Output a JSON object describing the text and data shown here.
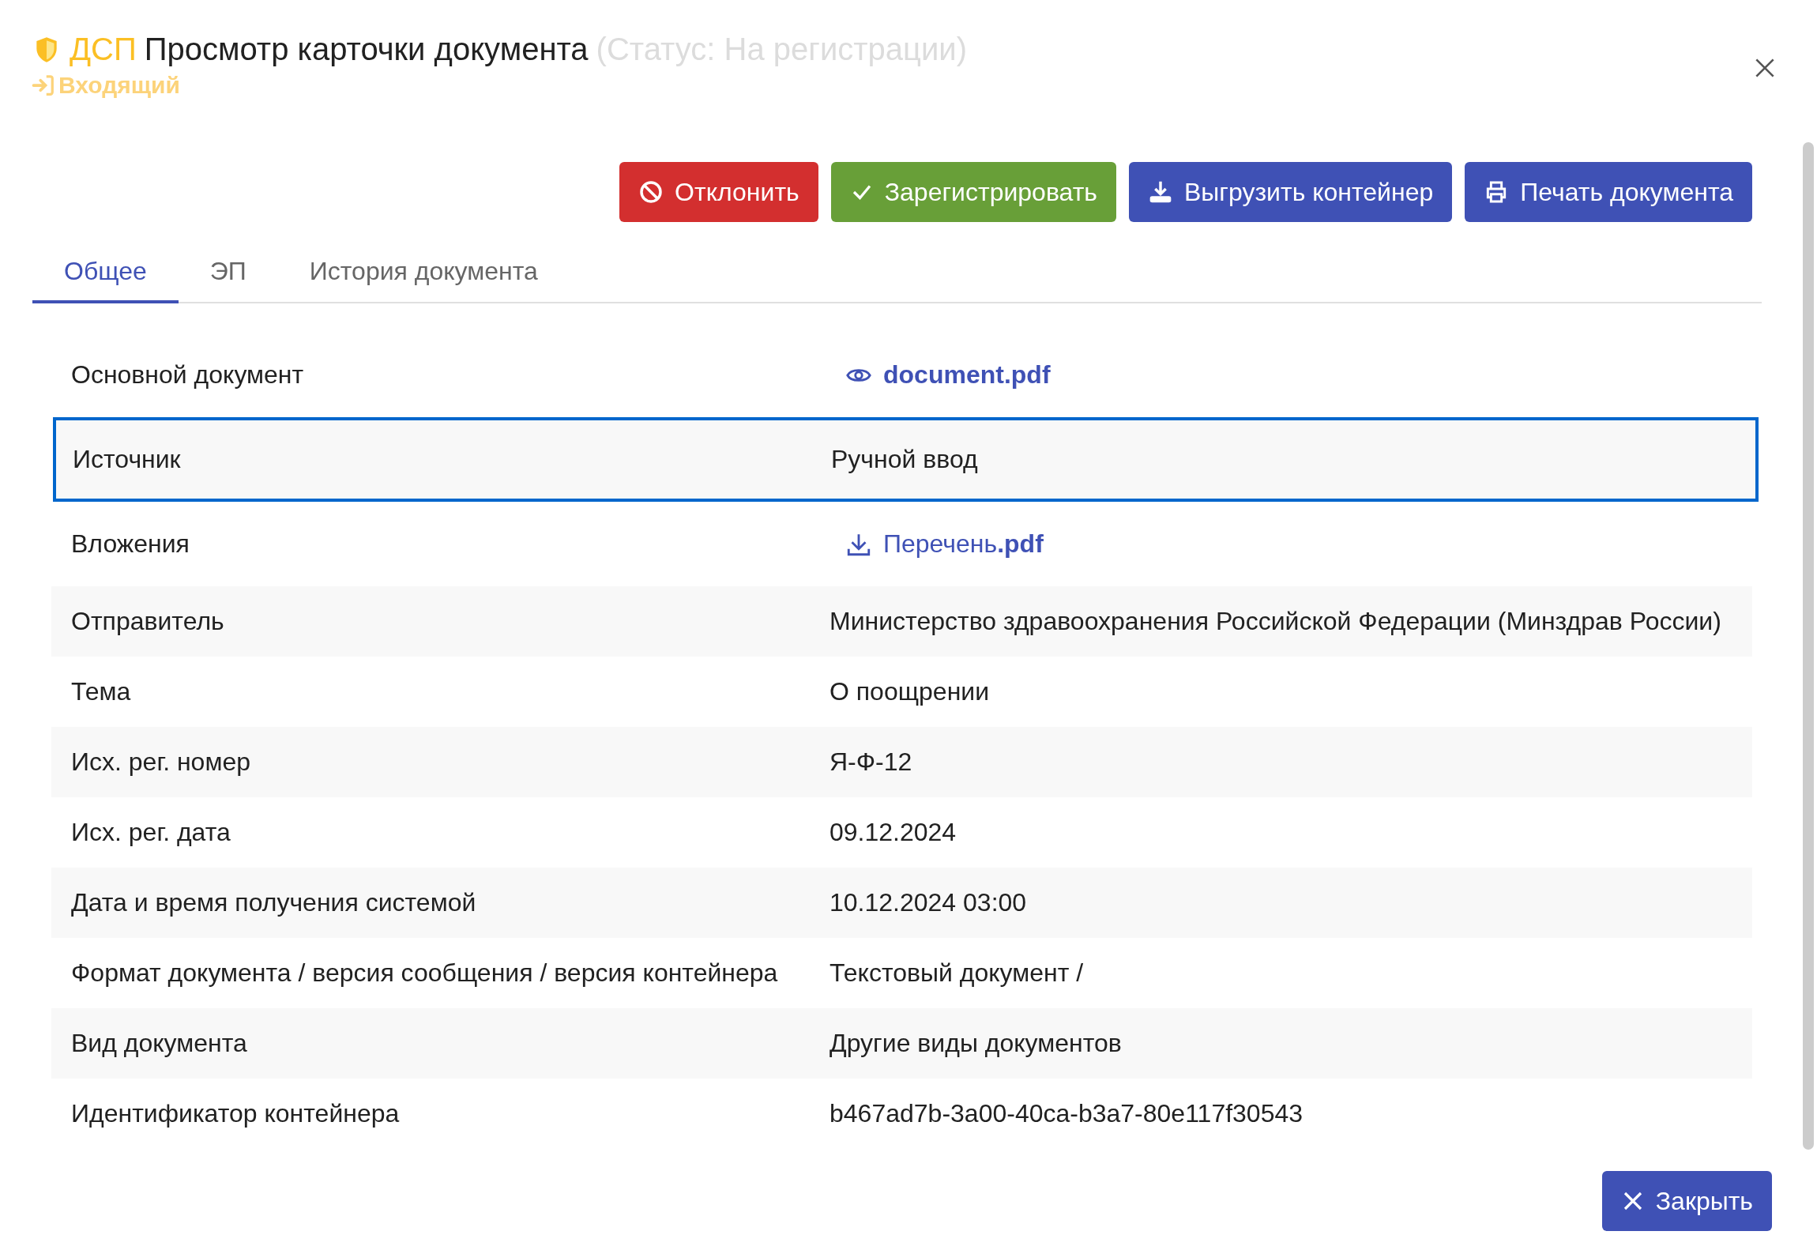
{
  "header": {
    "badge": "ДСП",
    "title": "Просмотр карточки документа",
    "status": "(Статус: На регистрации)",
    "direction": "Входящий"
  },
  "actions": [
    {
      "kind": "reject",
      "label": "Отклонить"
    },
    {
      "kind": "register",
      "label": "Зарегистрировать"
    },
    {
      "kind": "export",
      "label": "Выгрузить контейнер"
    },
    {
      "kind": "print",
      "label": "Печать документа"
    }
  ],
  "tabs": [
    {
      "label": "Общее",
      "selected": true
    },
    {
      "label": "ЭП",
      "selected": false
    },
    {
      "label": "История документа",
      "selected": false
    }
  ],
  "rows": [
    {
      "label": "Основной документ",
      "value": "document.pdf",
      "kind": "view-link",
      "focused": false
    },
    {
      "label": "Источник",
      "value": "Ручной ввод",
      "kind": "text",
      "focused": true
    },
    {
      "label": "Вложения",
      "value": "Перечень**.pdf**",
      "kind": "download-link",
      "focused": false
    },
    {
      "label": "Отправитель",
      "value": "Министерство здравоохранения Российской Федерации (Минздрав России)",
      "kind": "text",
      "focused": false
    },
    {
      "label": "Тема",
      "value": "О поощрении",
      "kind": "text",
      "focused": false
    },
    {
      "label": "Исх. рег. номер",
      "value": "Я-Ф-12",
      "kind": "text",
      "focused": false
    },
    {
      "label": "Исх. рег. дата",
      "value": "09.12.2024",
      "kind": "text",
      "focused": false
    },
    {
      "label": "Дата и время получения системой",
      "value": "10.12.2024 03:00",
      "kind": "text",
      "focused": false
    },
    {
      "label": "Формат документа / версия сообщения / версия контейнера",
      "value": "Текстовый документ /",
      "kind": "text",
      "focused": false
    },
    {
      "label": "Вид документа",
      "value": "Другие виды документов",
      "kind": "text",
      "focused": false
    },
    {
      "label": "Идентификатор контейнера",
      "value": "b467ad7b-3a00-40ca-b3a7-80e117f30543",
      "kind": "text",
      "focused": false
    }
  ],
  "footer": {
    "close": "Закрыть"
  }
}
